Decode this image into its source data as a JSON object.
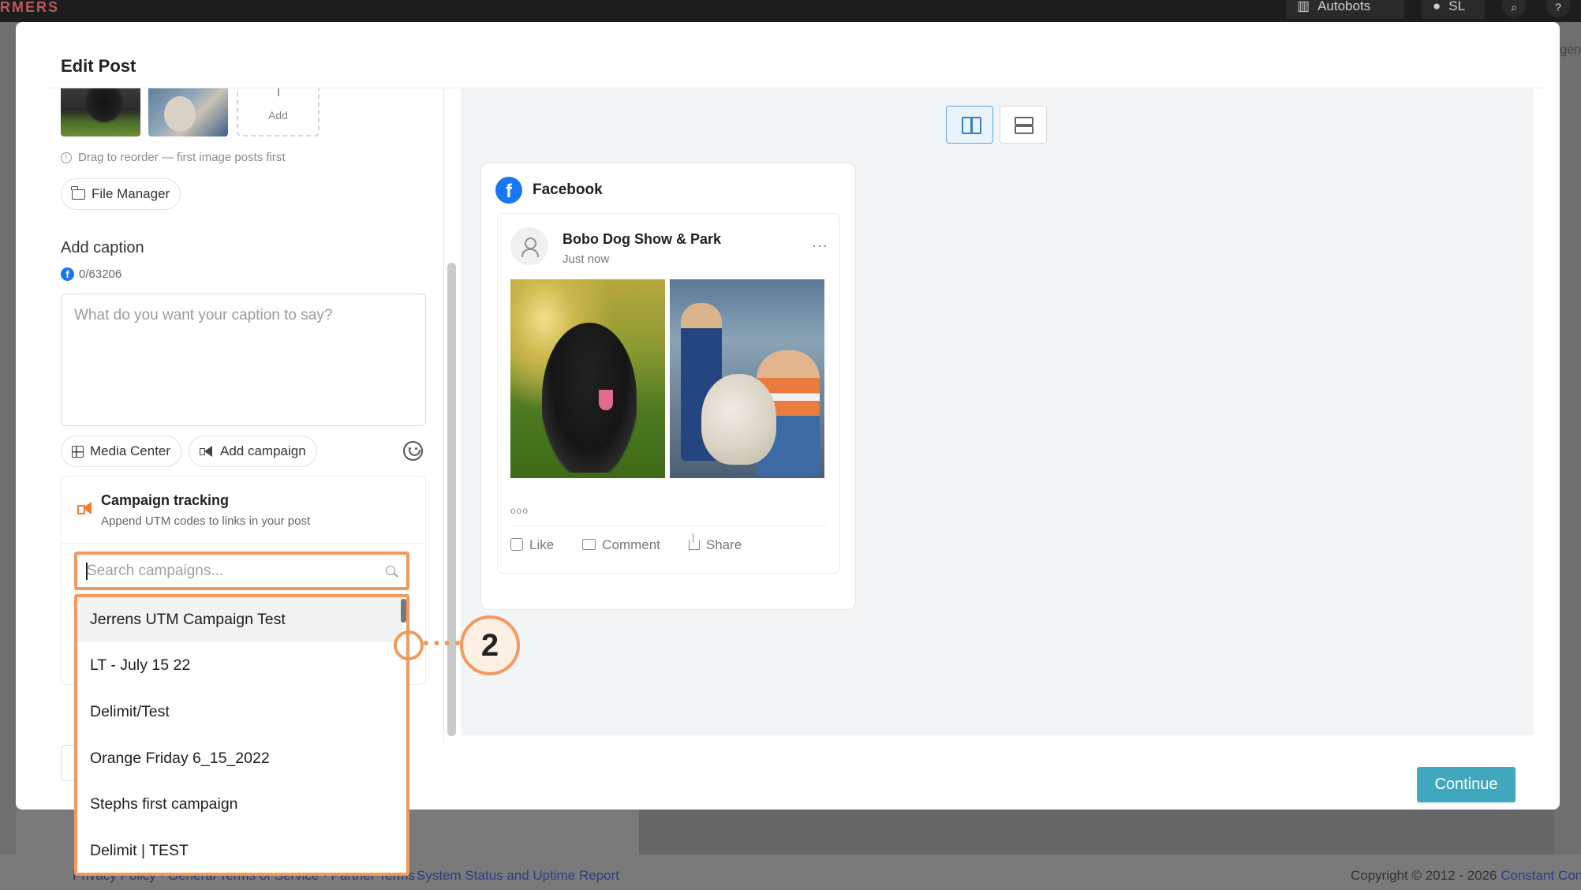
{
  "background": {
    "brand": "RMERS",
    "top_pill_label": "Autobots",
    "user_initials": "SL",
    "side_text": "gen",
    "footer_links": "Privacy Policy · General Terms of Service · Partner Terms ·",
    "footer_status": "System Status and Uptime Report",
    "footer_copyright_prefix": "Copyright © 2012 - 2026",
    "footer_copyright_brand": "Constant Con"
  },
  "modal": {
    "title": "Edit Post",
    "media": {
      "add_label": "Add",
      "reorder_hint": "Drag to reorder — first image posts first",
      "file_manager_label": "File Manager"
    },
    "caption": {
      "section_title": "Add caption",
      "counter": "0/63206",
      "placeholder": "What do you want your caption to say?"
    },
    "toolbar": {
      "media_center_label": "Media Center",
      "add_campaign_label": "Add campaign"
    },
    "campaign_tracking": {
      "title": "Campaign tracking",
      "subtitle": "Append UTM codes to links in your post",
      "search_placeholder": "Search campaigns...",
      "options": [
        "Jerrens UTM Campaign Test",
        "LT - July 15 22",
        "Delimit/Test",
        "Orange Friday 6_15_2022",
        "Stephs first campaign",
        "Delimit | TEST"
      ]
    },
    "preview": {
      "network": "Facebook",
      "page_name": "Bobo Dog Show & Park",
      "time": "Just now",
      "more": "···",
      "reactions": "ooo",
      "actions": {
        "like": "Like",
        "comment": "Comment",
        "share": "Share"
      }
    },
    "continue_label": "Continue"
  },
  "annotation": {
    "step_number": "2",
    "color": "#f29a5e"
  },
  "colors": {
    "facebook_blue": "#1877f2",
    "continue_button": "#41a7bf",
    "campaign_icon": "#f07d2b"
  }
}
